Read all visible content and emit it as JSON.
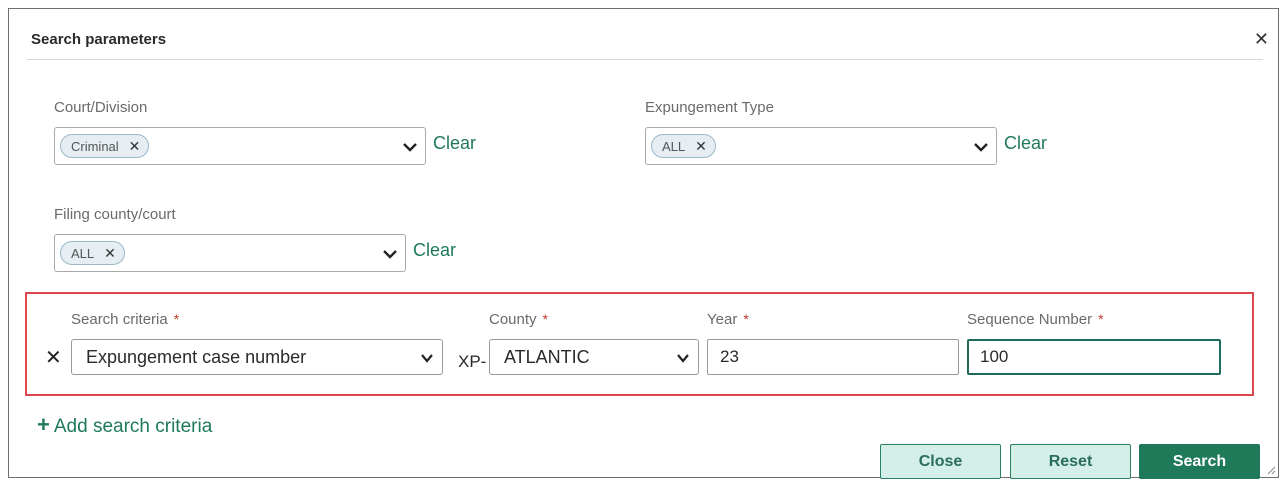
{
  "dialog": {
    "title": "Search parameters",
    "close_icon": "close-icon"
  },
  "filters": {
    "court_division": {
      "label": "Court/Division",
      "chip": "Criminal",
      "clear": "Clear"
    },
    "expungement_type": {
      "label": "Expungement Type",
      "chip": "ALL",
      "clear": "Clear"
    },
    "filing_county": {
      "label": "Filing county/court",
      "chip": "ALL",
      "clear": "Clear"
    }
  },
  "criteria": {
    "required_marker": "*",
    "search_criteria": {
      "label": "Search criteria",
      "value": "Expungement case number"
    },
    "prefix": "XP-",
    "county": {
      "label": "County",
      "value": "ATLANTIC"
    },
    "year": {
      "label": "Year",
      "value": "23"
    },
    "sequence": {
      "label": "Sequence Number",
      "value": "100"
    },
    "highlight_color": "#e0474c"
  },
  "add_criteria": {
    "plus": "+",
    "label": "Add search criteria"
  },
  "buttons": {
    "close": "Close",
    "reset": "Reset",
    "search": "Search"
  },
  "colors": {
    "accent": "#1f7a5a",
    "chip_bg": "#e6eef3",
    "required": "#c0392b"
  }
}
